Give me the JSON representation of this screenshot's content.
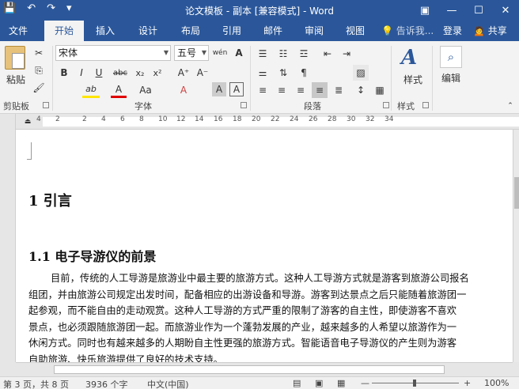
{
  "titlebar": {
    "title": "论文模板 - 副本 [兼容模式] - Word",
    "qat": {
      "save": "💾",
      "undo": "↶",
      "redo": "↷",
      "customize": "▾"
    },
    "window": {
      "restore": "▣",
      "minimize": "—",
      "maximize": "☐",
      "close": "✕"
    }
  },
  "tabs": [
    "文件",
    "开始",
    "插入",
    "设计",
    "布局",
    "引用",
    "邮件",
    "审阅",
    "视图"
  ],
  "tellme": "💡 告诉我...",
  "login": "登录",
  "share": "🙍 共享",
  "clipboard": {
    "paste_label": "粘贴",
    "group_label": "剪贴板"
  },
  "font": {
    "name": "宋体",
    "size": "五号",
    "group_label": "字体",
    "buttons": {
      "wen": "wén",
      "clear": "A",
      "bold": "B",
      "italic": "I",
      "underline": "U",
      "strike": "abc",
      "sub": "x₂",
      "sup": "x²",
      "grow": "A⁺",
      "shrink": "A⁻",
      "case": "Aa",
      "effect": "A",
      "highlight": "ab",
      "color": "A",
      "border": "A",
      "shade": "A"
    }
  },
  "paragraph": {
    "group_label": "段落"
  },
  "styles": {
    "label": "样式",
    "group_label": "样式"
  },
  "editing": {
    "label": "编辑"
  },
  "ruler": {
    "ticks": [
      "4",
      "2",
      "2",
      "4",
      "6",
      "8",
      "10",
      "12",
      "14",
      "16",
      "18",
      "20",
      "22",
      "24",
      "26",
      "28",
      "30",
      "32",
      "34"
    ]
  },
  "doc": {
    "h1": "1  引言",
    "h2": "1.1  电子导游仪的前景",
    "lines": [
      "目前，传统的人工导游是旅游业中最主要的旅游方式。这种人工导游方式就是游客到旅游公司报名",
      "组团，并由旅游公司规定出发时间，配备相应的出游设备和导游。游客到达景点之后只能随着旅游团一",
      "起参观，而不能自由的走动观赏。这种人工导游的方式严重的限制了游客的自主性，即使游客不喜欢",
      "景点，也必须跟随旅游团一起。而旅游业作为一个蓬勃发展的产业，越来越多的人希望以旅游作为一",
      "休闲方式。同时也有越来越多的人期盼自主性更强的旅游方式。智能语音电子导游仪的产生则为游客",
      "自助旅游、快乐旅游提供了良好的技术支持。"
    ]
  },
  "status": {
    "page": "第 3 页，共 8 页",
    "words": "3936 个字",
    "lang": "中文(中国)",
    "zoom": "100%",
    "zoom_minus": "—",
    "zoom_plus": "+"
  }
}
